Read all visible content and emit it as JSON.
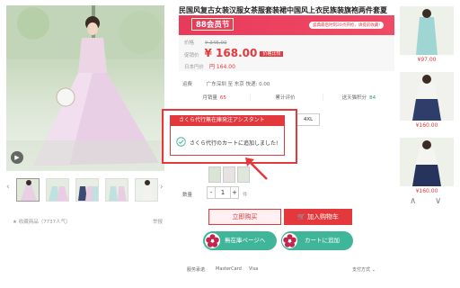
{
  "title": "民国风复古女装汉服女茶服套装裙中国风上衣民族装旗袍两件套夏",
  "promo": {
    "badge": "88会员节",
    "note": "盛典最后时刻20点开抢，请提前收藏!"
  },
  "price": {
    "orig_label": "价格",
    "orig_value": "¥ 345.00",
    "promo_label": "促销价",
    "promo_value": "¥ 168.00",
    "promo_tag": "价格比较",
    "cny_label": "日本円价",
    "cny_value": "円 164.00"
  },
  "shipping": {
    "label": "运费",
    "value": "广东深圳  至 东京  快递: 0.00"
  },
  "stats": [
    {
      "label": "月销量",
      "value": "65",
      "color": "#e4393c"
    },
    {
      "label": "累计评价",
      "value": "",
      "color": "#e4393c"
    },
    {
      "label": "送天猫积分",
      "value": "84",
      "color": "#2aa05a"
    }
  ],
  "sizes": [
    "4XL"
  ],
  "quantity": {
    "label": "数量",
    "value": "1",
    "minus": "-",
    "plus": "+",
    "stock": "件"
  },
  "buttons": {
    "buy_now": "立即购买",
    "add_cart": "加入购物车",
    "buyee_page": "無在庫ページへ",
    "buyee_cart": "カートに追加"
  },
  "popup": {
    "title": "さくら代行無在庫発注アシスタント",
    "message": "さくら代行のカートに追加しました!"
  },
  "gallery": {
    "favorite": "收藏商品（7737人气）",
    "report": "举报",
    "video_icon": "▶",
    "prev": "‹",
    "next": "›"
  },
  "footer": {
    "items": [
      "服务承诺",
      "MasterCard",
      "Visa"
    ],
    "pay": "支付方式"
  },
  "recommendations": [
    {
      "price": "¥97.00"
    },
    {
      "price": "¥160.00"
    },
    {
      "price": "¥160.00"
    }
  ],
  "rec_nav": {
    "up": "∧",
    "down": "∨"
  },
  "colors": {
    "accent": "#e4393c",
    "teal": "#3fb59a",
    "promo_bg": "#e83a5b"
  }
}
